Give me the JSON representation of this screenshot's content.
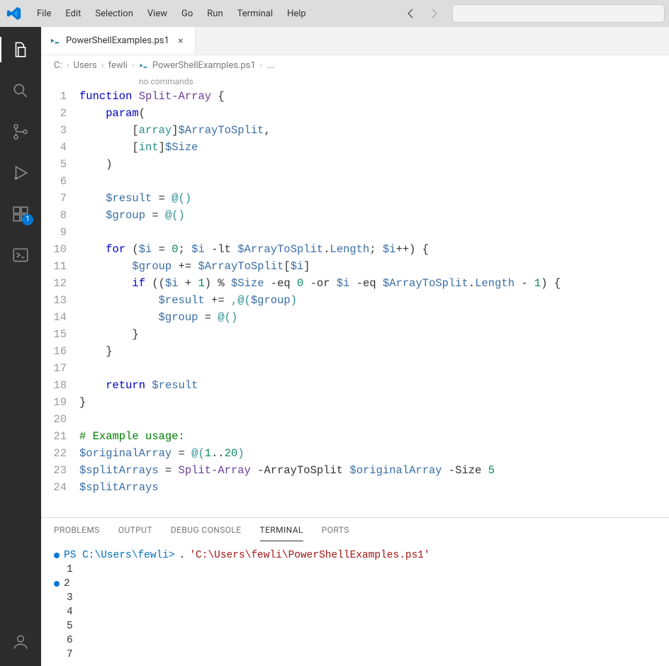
{
  "menu": {
    "items": [
      "File",
      "Edit",
      "Selection",
      "View",
      "Go",
      "Run",
      "Terminal",
      "Help"
    ]
  },
  "activitybar": {
    "badge": "1"
  },
  "tab": {
    "label": "PowerShellExamples.ps1"
  },
  "breadcrumbs": {
    "parts": [
      "C:",
      "Users",
      "fewli",
      "PowerShellExamples.ps1",
      "..."
    ]
  },
  "codelens": "no commands",
  "code": {
    "line_numbers": [
      "1",
      "2",
      "3",
      "4",
      "5",
      "6",
      "7",
      "8",
      "9",
      "10",
      "11",
      "12",
      "13",
      "14",
      "15",
      "16",
      "17",
      "18",
      "19",
      "20",
      "21",
      "22",
      "23",
      "24"
    ],
    "tokens": [
      [
        {
          "t": "function",
          "c": "kw"
        },
        {
          "t": " "
        },
        {
          "t": "Split-Array",
          "c": "fn"
        },
        {
          "t": " {"
        }
      ],
      [
        {
          "t": "    "
        },
        {
          "t": "param",
          "c": "kw"
        },
        {
          "t": "("
        }
      ],
      [
        {
          "t": "        ["
        },
        {
          "t": "array",
          "c": "type"
        },
        {
          "t": "]"
        },
        {
          "t": "$ArrayToSplit",
          "c": "var"
        },
        {
          "t": ","
        }
      ],
      [
        {
          "t": "        ["
        },
        {
          "t": "int",
          "c": "type"
        },
        {
          "t": "]"
        },
        {
          "t": "$Size",
          "c": "var"
        }
      ],
      [
        {
          "t": "    )"
        }
      ],
      [
        {
          "t": " "
        }
      ],
      [
        {
          "t": "    "
        },
        {
          "t": "$result",
          "c": "var"
        },
        {
          "t": " = "
        },
        {
          "t": "@()",
          "c": "type"
        }
      ],
      [
        {
          "t": "    "
        },
        {
          "t": "$group",
          "c": "var"
        },
        {
          "t": " = "
        },
        {
          "t": "@()",
          "c": "type"
        }
      ],
      [
        {
          "t": " "
        }
      ],
      [
        {
          "t": "    "
        },
        {
          "t": "for",
          "c": "kw"
        },
        {
          "t": " ("
        },
        {
          "t": "$i",
          "c": "var"
        },
        {
          "t": " = "
        },
        {
          "t": "0",
          "c": "num"
        },
        {
          "t": "; "
        },
        {
          "t": "$i",
          "c": "var"
        },
        {
          "t": " -lt "
        },
        {
          "t": "$ArrayToSplit",
          "c": "var"
        },
        {
          "t": "."
        },
        {
          "t": "Length",
          "c": "prop"
        },
        {
          "t": "; "
        },
        {
          "t": "$i",
          "c": "var"
        },
        {
          "t": "++) {"
        }
      ],
      [
        {
          "t": "        "
        },
        {
          "t": "$group",
          "c": "var"
        },
        {
          "t": " += "
        },
        {
          "t": "$ArrayToSplit",
          "c": "var"
        },
        {
          "t": "["
        },
        {
          "t": "$i",
          "c": "var"
        },
        {
          "t": "]"
        }
      ],
      [
        {
          "t": "        "
        },
        {
          "t": "if",
          "c": "kw"
        },
        {
          "t": " (("
        },
        {
          "t": "$i",
          "c": "var"
        },
        {
          "t": " + "
        },
        {
          "t": "1",
          "c": "num"
        },
        {
          "t": ") % "
        },
        {
          "t": "$Size",
          "c": "var"
        },
        {
          "t": " -eq "
        },
        {
          "t": "0",
          "c": "num"
        },
        {
          "t": " -or "
        },
        {
          "t": "$i",
          "c": "var"
        },
        {
          "t": " -eq "
        },
        {
          "t": "$ArrayToSplit",
          "c": "var"
        },
        {
          "t": "."
        },
        {
          "t": "Length",
          "c": "prop"
        },
        {
          "t": " - "
        },
        {
          "t": "1",
          "c": "num"
        },
        {
          "t": ") {"
        }
      ],
      [
        {
          "t": "            "
        },
        {
          "t": "$result",
          "c": "var"
        },
        {
          "t": " += "
        },
        {
          "t": ",@(",
          "c": "type"
        },
        {
          "t": "$group",
          "c": "var"
        },
        {
          "t": ")",
          "c": "type"
        }
      ],
      [
        {
          "t": "            "
        },
        {
          "t": "$group",
          "c": "var"
        },
        {
          "t": " = "
        },
        {
          "t": "@()",
          "c": "type"
        }
      ],
      [
        {
          "t": "        }"
        }
      ],
      [
        {
          "t": "    }"
        }
      ],
      [
        {
          "t": " "
        }
      ],
      [
        {
          "t": "    "
        },
        {
          "t": "return",
          "c": "kw"
        },
        {
          "t": " "
        },
        {
          "t": "$result",
          "c": "var"
        }
      ],
      [
        {
          "t": "}"
        }
      ],
      [
        {
          "t": " "
        }
      ],
      [
        {
          "t": "# Example usage:",
          "c": "cm"
        }
      ],
      [
        {
          "t": "$originalArray",
          "c": "var"
        },
        {
          "t": " = "
        },
        {
          "t": "@(",
          "c": "type"
        },
        {
          "t": "1",
          "c": "num"
        },
        {
          "t": ".."
        },
        {
          "t": "20",
          "c": "num"
        },
        {
          "t": ")",
          "c": "type"
        }
      ],
      [
        {
          "t": "$splitArrays",
          "c": "var"
        },
        {
          "t": " = "
        },
        {
          "t": "Split-Array",
          "c": "fn"
        },
        {
          "t": " -ArrayToSplit "
        },
        {
          "t": "$originalArray",
          "c": "var"
        },
        {
          "t": " -Size "
        },
        {
          "t": "5",
          "c": "num"
        }
      ],
      [
        {
          "t": "$splitArrays",
          "c": "var"
        }
      ]
    ]
  },
  "panel": {
    "tabs": [
      "PROBLEMS",
      "OUTPUT",
      "DEBUG CONSOLE",
      "TERMINAL",
      "PORTS"
    ],
    "active_index": 3
  },
  "terminal": {
    "prompt_prefix": "PS C:\\Users\\fewli>",
    "prompt_cmd_dot": ".",
    "prompt_cmd_path": "'C:\\Users\\fewli\\PowerShellExamples.ps1'",
    "output_lines": [
      "1",
      "2",
      "3",
      "4",
      "5",
      "6",
      "7"
    ],
    "dot_lines": [
      0,
      1
    ]
  }
}
